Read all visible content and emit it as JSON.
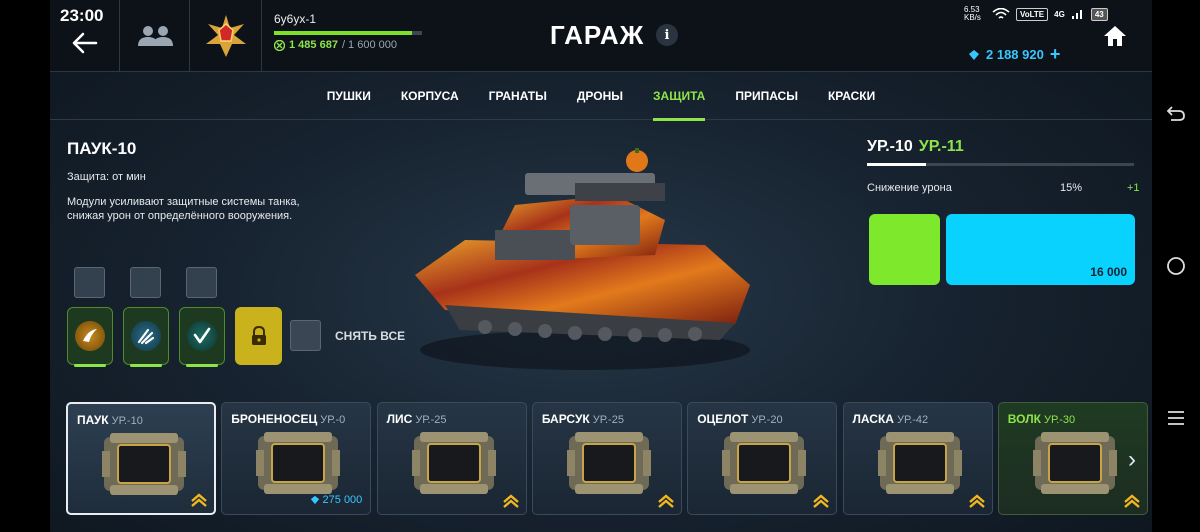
{
  "status": {
    "time": "23:00",
    "net_speed": "6.53 KB/s",
    "volte": "VoLTE",
    "network": "4G",
    "battery": "43"
  },
  "header": {
    "title": "ГАРАЖ",
    "info": "i",
    "player_name": "6y6yx-1",
    "xp_current": "1 485 687",
    "xp_max": "/ 1 600 000",
    "xp_fraction": 0.93,
    "crystals": "2 188 920",
    "plus": "+"
  },
  "tabs": [
    {
      "label": "ПУШКИ"
    },
    {
      "label": "КОРПУСА"
    },
    {
      "label": "ГРАНАТЫ"
    },
    {
      "label": "ДРОНЫ"
    },
    {
      "label": "ЗАЩИТА",
      "active": true
    },
    {
      "label": "ПРИПАСЫ"
    },
    {
      "label": "КРАСКИ"
    }
  ],
  "module": {
    "name": "ПАУК-10",
    "protection": "Защита: от мин",
    "description": "Модули усиливают защитные системы танка, снижая урон от определённого вооружения.",
    "unequip_all": "СНЯТЬ ВСЕ"
  },
  "upgrade": {
    "level_current": "УР.-10",
    "level_next": "УР.-11",
    "level_progress": 0.22,
    "stat_label": "Снижение урона",
    "stat_value": "15%",
    "stat_increase": "+1",
    "price": "16 000",
    "colors": {
      "green": "#7de82c",
      "blue": "#0ad2ff"
    }
  },
  "cards": [
    {
      "name": "ПАУК",
      "level": "УР.-10",
      "selected": true
    },
    {
      "name": "БРОНЕНОСЕЦ",
      "level": "УР.-0",
      "price": "275 000"
    },
    {
      "name": "ЛИС",
      "level": "УР.-25"
    },
    {
      "name": "БАРСУК",
      "level": "УР.-25"
    },
    {
      "name": "ОЦЕЛОТ",
      "level": "УР.-20"
    },
    {
      "name": "ЛАСКА",
      "level": "УР.-42"
    },
    {
      "name": "ВОЛК",
      "level": "УР.-30",
      "equipped": true
    }
  ],
  "icons": [
    "back-arrow-icon",
    "friends-icon",
    "rank-star-icon",
    "home-icon",
    "crystal-icon",
    "lock-icon",
    "chevron-right-icon"
  ]
}
